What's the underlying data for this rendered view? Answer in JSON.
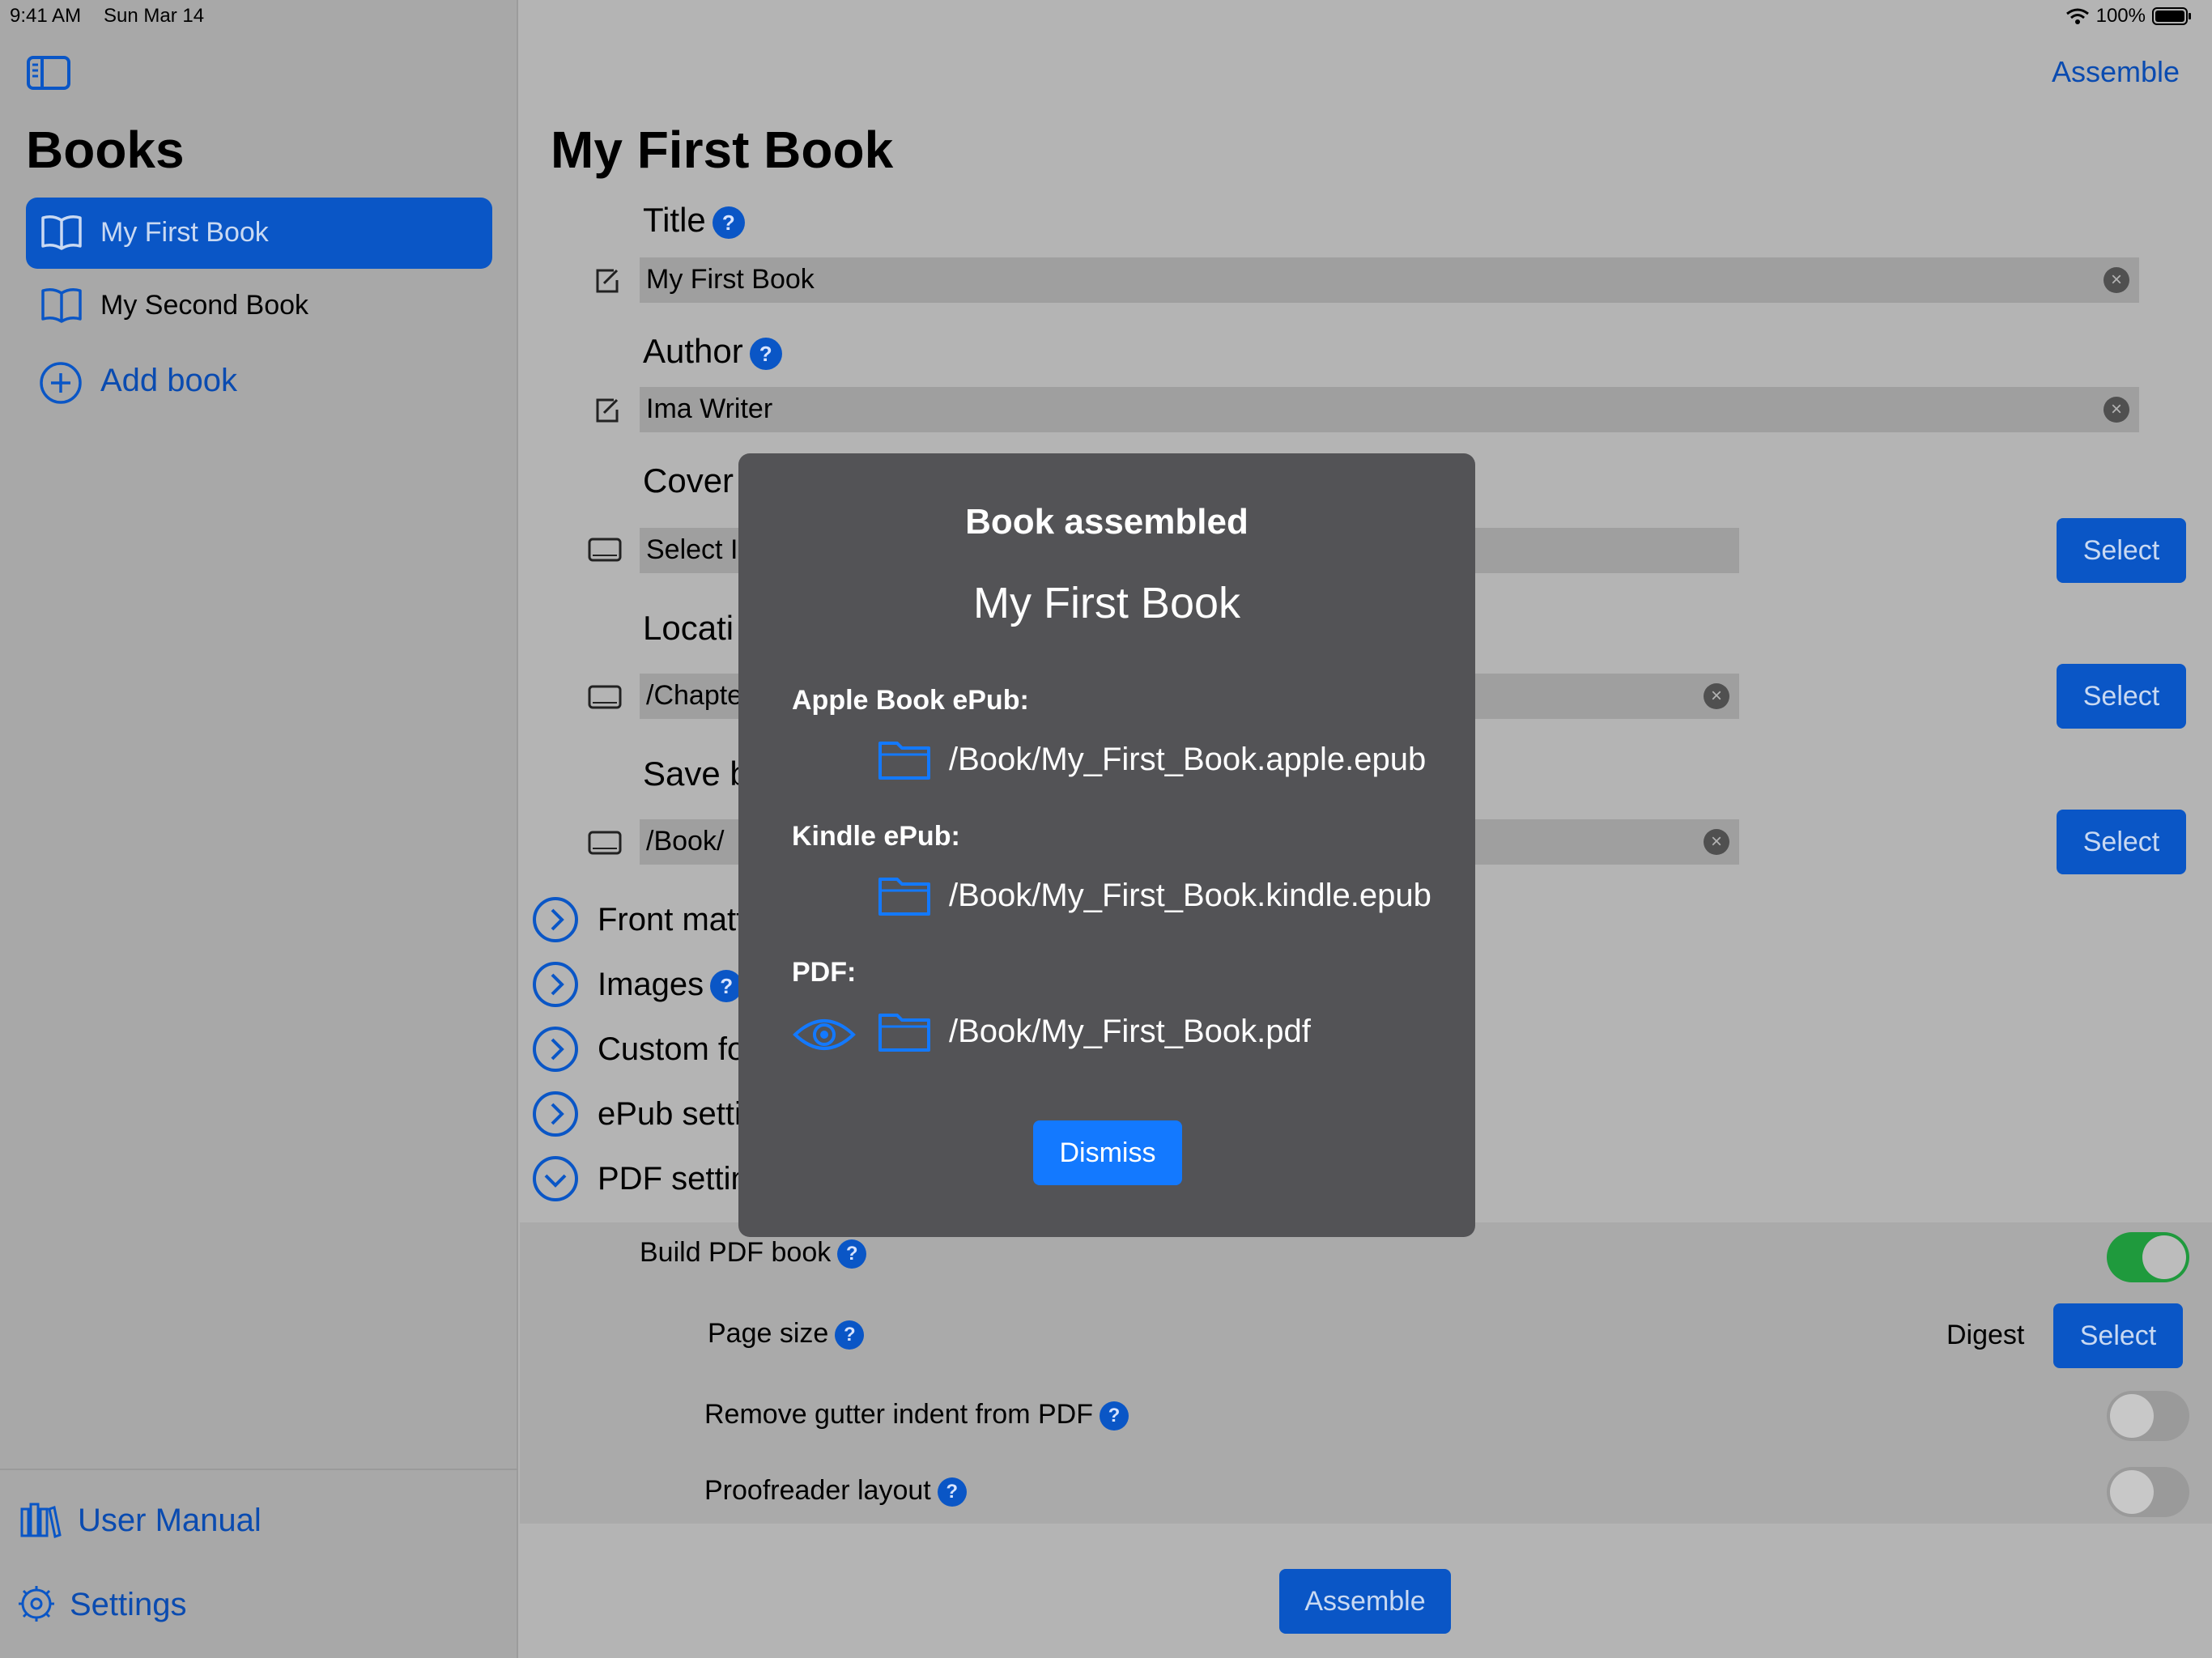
{
  "status_bar": {
    "time": "9:41 AM",
    "date": "Sun Mar 14",
    "battery": "100%"
  },
  "sidebar": {
    "title": "Books",
    "items": [
      {
        "label": "My First Book",
        "selected": true
      },
      {
        "label": "My Second Book",
        "selected": false
      }
    ],
    "add_label": "Add book",
    "footer": {
      "manual_label": "User Manual",
      "settings_label": "Settings"
    }
  },
  "toolbar": {
    "assemble_label": "Assemble"
  },
  "main": {
    "title": "My First Book",
    "title_label": "Title",
    "title_value": "My First Book",
    "author_label": "Author",
    "author_value": "Ima Writer",
    "cover_label": "Cover",
    "cover_value": "Select I",
    "location_label": "Locati",
    "location_value": "/Chapte",
    "save_label": "Save b",
    "save_value": "/Book/",
    "select_label": "Select",
    "sections": [
      {
        "label": "Front matt",
        "expanded": false,
        "help": false
      },
      {
        "label": "Images",
        "expanded": false,
        "help": true
      },
      {
        "label": "Custom fo",
        "expanded": false,
        "help": false
      },
      {
        "label": "ePub setti",
        "expanded": false,
        "help": false
      },
      {
        "label": "PDF settin",
        "expanded": true,
        "help": false
      }
    ],
    "pdf": {
      "build_label": "Build PDF book",
      "build_on": true,
      "page_size_label": "Page size",
      "page_size_value": "Digest",
      "gutter_label": "Remove gutter indent from PDF",
      "gutter_on": false,
      "proof_label": "Proofreader layout",
      "proof_on": false
    },
    "assemble_button": "Assemble"
  },
  "modal": {
    "heading": "Book assembled",
    "book": "My First Book",
    "apple_label": "Apple Book ePub:",
    "apple_path": "/Book/My_First_Book.apple.epub",
    "kindle_label": "Kindle ePub:",
    "kindle_path": "/Book/My_First_Book.kindle.epub",
    "pdf_label": "PDF:",
    "pdf_path": "/Book/My_First_Book.pdf",
    "dismiss_label": "Dismiss"
  },
  "colors": {
    "accent": "#0a56c6",
    "modal_bg": "#535356",
    "dismiss": "#1379ff",
    "toggle_on": "#1f9a3d"
  },
  "icons": [
    "sidebar-toggle-icon",
    "book-icon",
    "plus-circle-icon",
    "books-icon",
    "gear-icon",
    "edit-icon",
    "drive-icon",
    "chevron-right-icon",
    "chevron-down-icon",
    "folder-icon",
    "eye-icon",
    "clear-icon",
    "help-icon",
    "wifi-icon",
    "battery-icon"
  ]
}
